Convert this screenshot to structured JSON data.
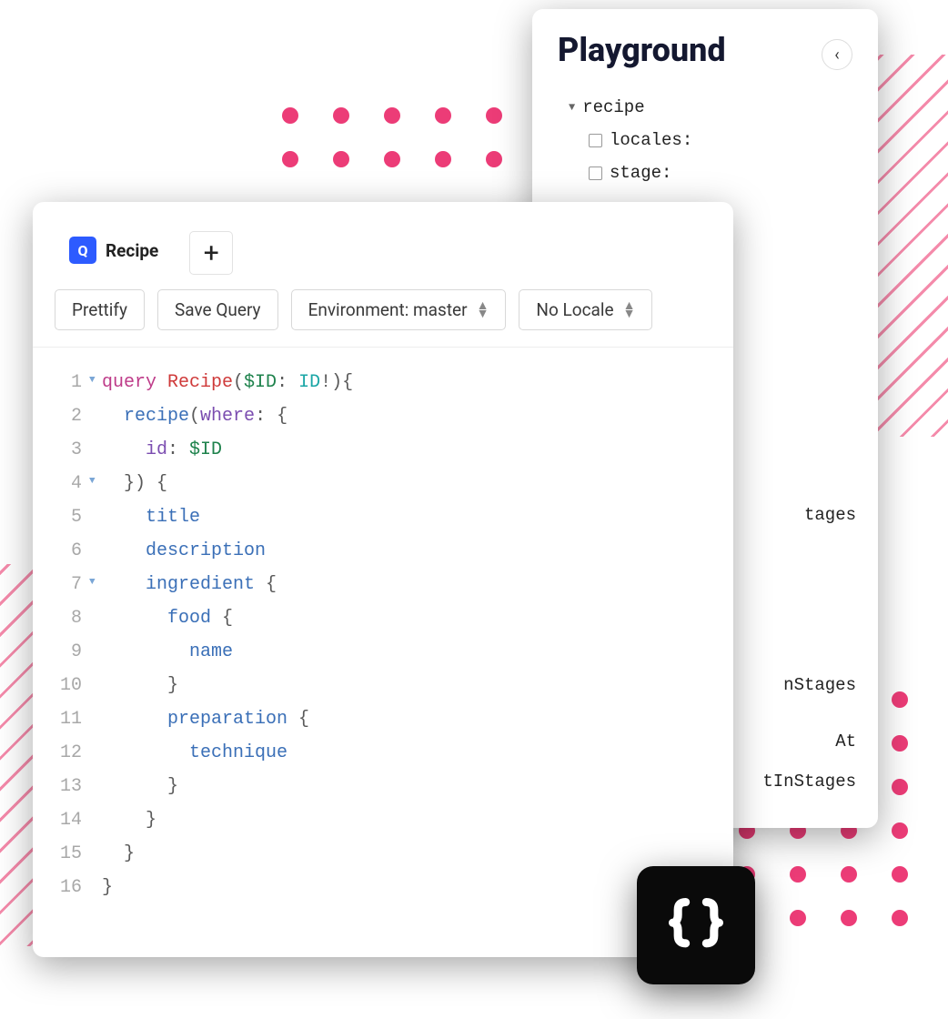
{
  "playground": {
    "title": "Playground",
    "tree_root": "recipe",
    "tree_children": [
      "locales:",
      "stage:"
    ],
    "fragments": [
      "tages",
      "nStages",
      "At",
      "tInStages"
    ]
  },
  "editor": {
    "tab_badge": "Q",
    "tab_label": "Recipe",
    "toolbar": {
      "prettify": "Prettify",
      "save": "Save Query",
      "environment": "Environment: master",
      "locale": "No Locale"
    },
    "code": [
      {
        "n": 1,
        "fold": true,
        "tokens": [
          [
            "kw",
            "query "
          ],
          [
            "name",
            "Recipe"
          ],
          [
            "pun",
            "("
          ],
          [
            "var",
            "$ID"
          ],
          [
            "pun",
            ": "
          ],
          [
            "typ",
            "ID"
          ],
          [
            "pun",
            "!){"
          ]
        ]
      },
      {
        "n": 2,
        "fold": false,
        "tokens": [
          [
            "pun",
            "  "
          ],
          [
            "fld",
            "recipe"
          ],
          [
            "pun",
            "("
          ],
          [
            "arg",
            "where"
          ],
          [
            "pun",
            ": {"
          ]
        ]
      },
      {
        "n": 3,
        "fold": false,
        "tokens": [
          [
            "pun",
            "    "
          ],
          [
            "arg",
            "id"
          ],
          [
            "pun",
            ": "
          ],
          [
            "var",
            "$ID"
          ]
        ]
      },
      {
        "n": 4,
        "fold": true,
        "tokens": [
          [
            "pun",
            "  }) {"
          ]
        ]
      },
      {
        "n": 5,
        "fold": false,
        "tokens": [
          [
            "pun",
            "    "
          ],
          [
            "fld",
            "title"
          ]
        ]
      },
      {
        "n": 6,
        "fold": false,
        "tokens": [
          [
            "pun",
            "    "
          ],
          [
            "fld",
            "description"
          ]
        ]
      },
      {
        "n": 7,
        "fold": true,
        "tokens": [
          [
            "pun",
            "    "
          ],
          [
            "fld",
            "ingredient"
          ],
          [
            "pun",
            " {"
          ]
        ]
      },
      {
        "n": 8,
        "fold": false,
        "tokens": [
          [
            "pun",
            "      "
          ],
          [
            "fld",
            "food"
          ],
          [
            "pun",
            " {"
          ]
        ]
      },
      {
        "n": 9,
        "fold": false,
        "tokens": [
          [
            "pun",
            "        "
          ],
          [
            "fld",
            "name"
          ]
        ]
      },
      {
        "n": 10,
        "fold": false,
        "tokens": [
          [
            "pun",
            "      }"
          ]
        ]
      },
      {
        "n": 11,
        "fold": false,
        "tokens": [
          [
            "pun",
            "      "
          ],
          [
            "fld",
            "preparation"
          ],
          [
            "pun",
            " {"
          ]
        ]
      },
      {
        "n": 12,
        "fold": false,
        "tokens": [
          [
            "pun",
            "        "
          ],
          [
            "fld",
            "technique"
          ]
        ]
      },
      {
        "n": 13,
        "fold": false,
        "tokens": [
          [
            "pun",
            "      }"
          ]
        ]
      },
      {
        "n": 14,
        "fold": false,
        "tokens": [
          [
            "pun",
            "    }"
          ]
        ]
      },
      {
        "n": 15,
        "fold": false,
        "tokens": [
          [
            "pun",
            "  }"
          ]
        ]
      },
      {
        "n": 16,
        "fold": false,
        "tokens": [
          [
            "pun",
            "}"
          ]
        ]
      }
    ]
  }
}
